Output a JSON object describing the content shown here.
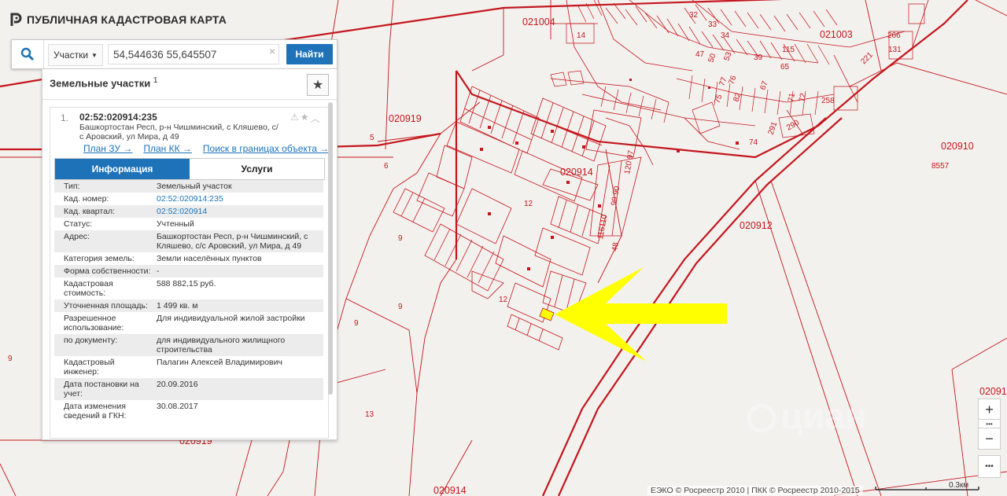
{
  "app": {
    "title": "ПУБЛИЧНАЯ КАДАСТРОВАЯ КАРТА"
  },
  "search": {
    "type_label": "Участки",
    "query": "54,544636 55,645507",
    "clear": "×",
    "button": "Найти"
  },
  "panel": {
    "heading": "Земельные участки",
    "count": "1",
    "result": {
      "index": "1.",
      "cad_number": "02:52:020914:235",
      "address_line1": "Башкортостан Респ, р-н Чишминский, с Кляшево, с/",
      "address_line2": "с Аровский, ул Мира, д 49",
      "links": [
        "План ЗУ →",
        "План КК →",
        "Поиск в границах объекта →"
      ]
    },
    "tabs": [
      "Информация",
      "Услуги"
    ],
    "props": [
      {
        "k": "Тип:",
        "v": "Земельный участок"
      },
      {
        "k": "Кад. номер:",
        "v": "02:52:020914:235",
        "link": true
      },
      {
        "k": "Кад. квартал:",
        "v": "02:52:020914",
        "link": true
      },
      {
        "k": "Статус:",
        "v": "Учтенный"
      },
      {
        "k": "Адрес:",
        "v": "Башкортостан Респ, р-н Чишминский, с Кляшево, с/с Аровский, ул Мира, д 49"
      },
      {
        "k": "Категория земель:",
        "v": "Земли населённых пунктов"
      },
      {
        "k": "Форма собственности:",
        "v": "-"
      },
      {
        "k": "Кадастровая стоимость:",
        "v": "588 882,15 руб."
      },
      {
        "k": "Уточненная площадь:",
        "v": "1 499 кв. м"
      },
      {
        "k": "Разрешенное использование:",
        "v": "Для индивидуальной жилой застройки"
      },
      {
        "k": "по документу:",
        "v": "для индивидуального жилищного строительства"
      },
      {
        "k": "Кадастровый инженер:",
        "v": "Палагин Алексей Владимирович"
      },
      {
        "k": "Дата постановки на учет:",
        "v": "20.09.2016"
      },
      {
        "k": "Дата изменения сведений в ГКН:",
        "v": "30.08.2017"
      }
    ]
  },
  "map": {
    "labels": [
      "021004",
      "021003",
      "020919",
      "020914",
      "020912",
      "020910",
      "8557",
      "020919",
      "020914",
      "02091"
    ],
    "small_labels": [
      "14",
      "131",
      "266",
      "221",
      "65",
      "258",
      "74",
      "290",
      "291",
      "72",
      "71",
      "67",
      "5",
      "6",
      "9",
      "9",
      "9",
      "9",
      "12",
      "12",
      "13",
      "48",
      "116110",
      "99 90",
      "120 97",
      "32",
      "33",
      "34",
      "47",
      "50",
      "53",
      "39",
      "115",
      "82",
      "75",
      "77",
      "76"
    ],
    "accent_color": "#c4161c",
    "arrow_color": "#ffff00"
  },
  "controls": {
    "zoom_in": "+",
    "zoom_out": "−",
    "more": "•••"
  },
  "attribution": "ЕЭКО © Росреестр 2010 | ПКК © Росреестр 2010-2015",
  "scale": "0.3км",
  "watermark": "циан"
}
